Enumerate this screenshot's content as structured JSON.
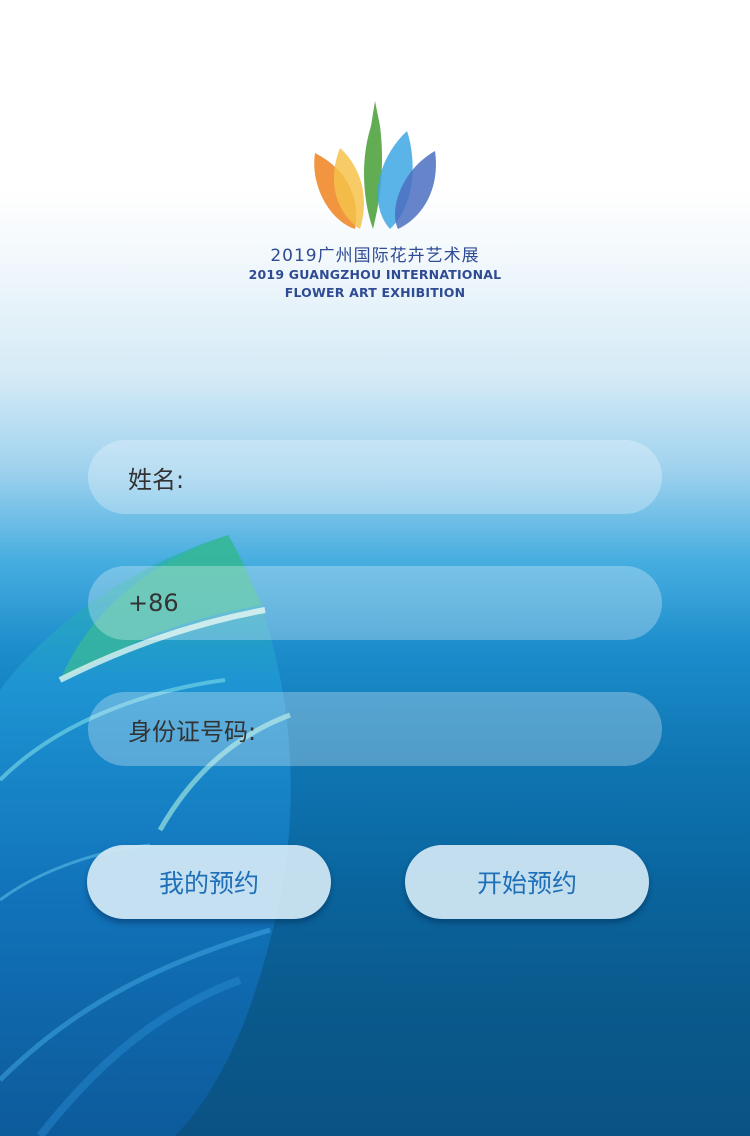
{
  "logo": {
    "title_cn": "2019广州国际花卉艺术展",
    "title_en_line1": "2019 GUANGZHOU INTERNATIONAL",
    "title_en_line2": "FLOWER ART EXHIBITION"
  },
  "form": {
    "name_label": "姓名:",
    "phone_label": "+86",
    "id_label": "身份证号码:"
  },
  "buttons": {
    "my_booking": "我的预约",
    "start_booking": "开始预约"
  },
  "colors": {
    "logo_text": "#2f4b93",
    "button_text": "#1f6fb8",
    "field_label": "#333333"
  }
}
